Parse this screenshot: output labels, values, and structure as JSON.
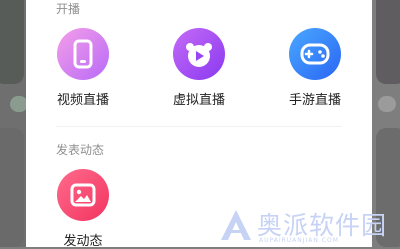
{
  "sections": {
    "live": {
      "title": "开播",
      "items": [
        {
          "label": "视频直播",
          "icon": "phone-icon"
        },
        {
          "label": "虚拟直播",
          "icon": "bear-play-icon"
        },
        {
          "label": "手游直播",
          "icon": "gamepad-icon"
        }
      ]
    },
    "post": {
      "title": "发表动态",
      "items": [
        {
          "label": "发动态",
          "icon": "image-icon"
        }
      ]
    }
  },
  "watermark": {
    "text": "奥派软件园",
    "subtext": "AUPAIRUANJIAN.COM"
  },
  "colors": {
    "video": "#c77af5",
    "virtual": "#9a45f2",
    "game": "#3584f8",
    "post": "#f44468"
  }
}
